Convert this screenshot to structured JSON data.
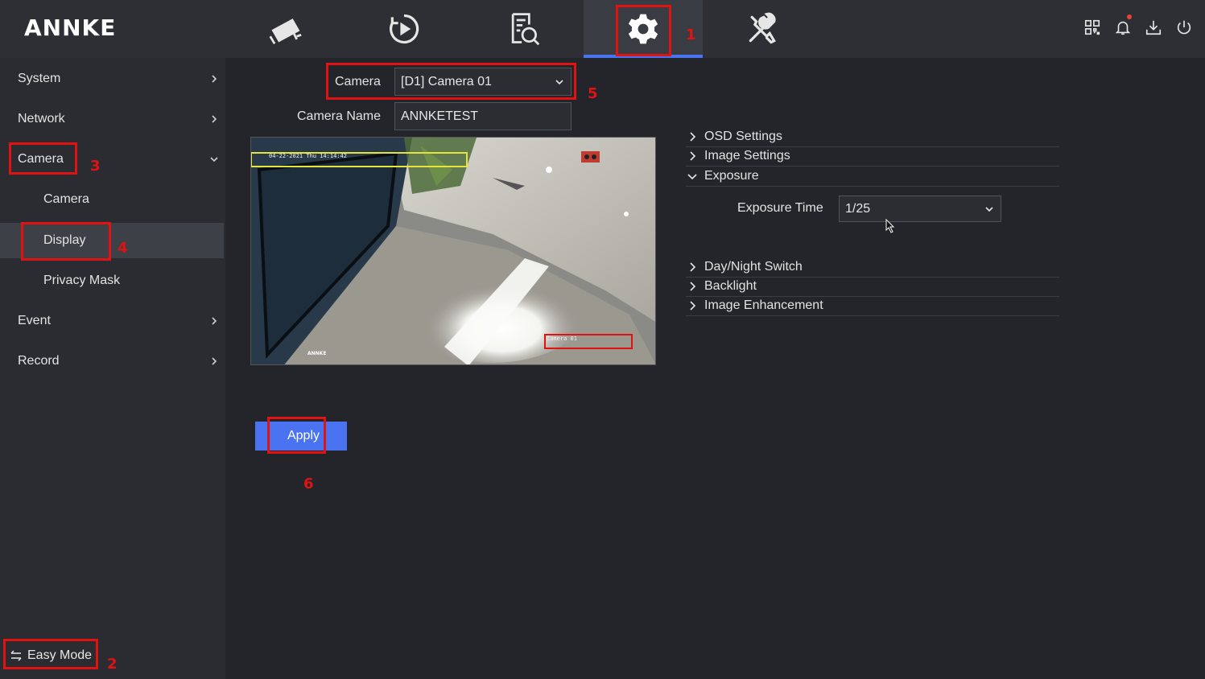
{
  "brand": {
    "logo": "ANNKE"
  },
  "top_tabs": [
    {
      "name": "live-view",
      "icon": "camera-icon"
    },
    {
      "name": "playback",
      "icon": "playback-icon"
    },
    {
      "name": "search",
      "icon": "file-search-icon"
    },
    {
      "name": "configuration",
      "icon": "gear-icon",
      "active": true
    },
    {
      "name": "maintenance",
      "icon": "tools-icon"
    }
  ],
  "toolbar_icons": [
    "qr-code-icon",
    "bell-icon",
    "download-icon",
    "power-icon"
  ],
  "sidebar": {
    "items": [
      {
        "label": "System"
      },
      {
        "label": "Network"
      },
      {
        "label": "Camera",
        "expanded": true
      },
      {
        "label": "Camera"
      },
      {
        "label": "Display",
        "selected": true
      },
      {
        "label": "Privacy Mask"
      },
      {
        "label": "Event"
      },
      {
        "label": "Record"
      }
    ],
    "easy_mode": "Easy Mode"
  },
  "form": {
    "camera_label": "Camera",
    "camera_value": "[D1] Camera 01",
    "camera_name_label": "Camera Name",
    "camera_name_value": "ANNKETEST"
  },
  "preview": {
    "osd_datetime": "04-22-2021 Thu 14:14:42",
    "osd_camera_name": "Camera 01",
    "osd_logo": "ANNKE"
  },
  "sections": [
    {
      "label": "OSD Settings",
      "expanded": false
    },
    {
      "label": "Image Settings",
      "expanded": false
    },
    {
      "label": "Exposure",
      "expanded": true
    },
    {
      "label": "Day/Night Switch",
      "expanded": false
    },
    {
      "label": "Backlight",
      "expanded": false
    },
    {
      "label": "Image Enhancement",
      "expanded": false
    }
  ],
  "exposure": {
    "label": "Exposure Time",
    "value": "1/25"
  },
  "apply_label": "Apply",
  "annotations": [
    "1",
    "2",
    "3",
    "4",
    "5",
    "6"
  ],
  "colors": {
    "accent": "#4a73f2",
    "annotation": "#e01212",
    "background": "#23252b",
    "sidebar": "#2a2c32"
  }
}
